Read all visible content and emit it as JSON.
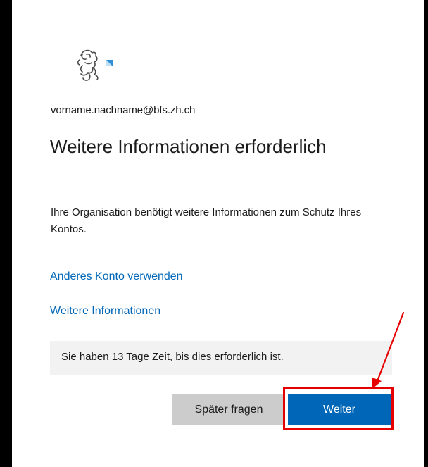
{
  "account": {
    "email": "vorname.nachname@bfs.zh.ch"
  },
  "heading": {
    "title": "Weitere Informationen erforderlich"
  },
  "body": {
    "description": "Ihre Organisation benötigt weitere Informationen zum Schutz Ihres Kontos."
  },
  "links": {
    "other_account": "Anderes Konto verwenden",
    "more_info": "Weitere Informationen"
  },
  "notice": {
    "text": "Sie haben 13 Tage Zeit, bis dies erforderlich ist."
  },
  "buttons": {
    "later": "Später fragen",
    "next": "Weiter"
  },
  "colors": {
    "primary": "#0067b8",
    "link": "#0067b8",
    "annotation": "#e60000",
    "notice_bg": "#f2f2f2",
    "secondary_button": "#cccccc"
  },
  "icons": {
    "logo": "zurich-lion-logo",
    "annotation": "red-arrow-icon"
  }
}
